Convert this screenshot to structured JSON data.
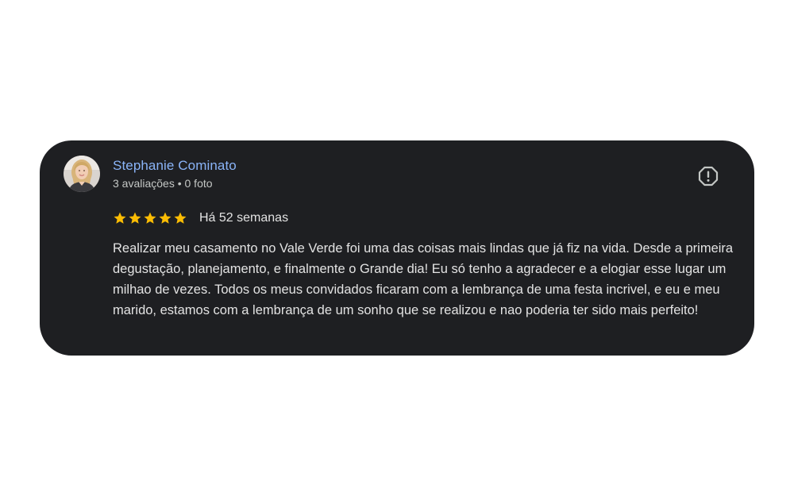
{
  "review": {
    "reviewer_name": "Stephanie Cominato",
    "reviewer_meta": "3 avaliações • 0 foto",
    "rating": 5,
    "rating_max": 5,
    "date": "Há 52 semanas",
    "text": "Realizar meu casamento no Vale Verde foi uma das coisas mais lindas que já fiz na vida. Desde a primeira degustação, planejamento, e finalmente o Grande dia! Eu só tenho a agradecer e a elogiar esse lugar um milhao de vezes. Todos os meus convidados ficaram com a lembrança de uma festa incrivel, e eu e meu marido, estamos com a lembrança de um sonho que se realizou e nao poderia ter sido mais perfeito!"
  },
  "icons": {
    "avatar": "avatar-photo",
    "report": "report-icon",
    "star": "star-icon"
  },
  "colors": {
    "card_background": "#1e1f22",
    "name": "#8ab4f8",
    "star": "#fbbc04",
    "text": "#e3e3e3",
    "meta": "#c4c7c5"
  }
}
